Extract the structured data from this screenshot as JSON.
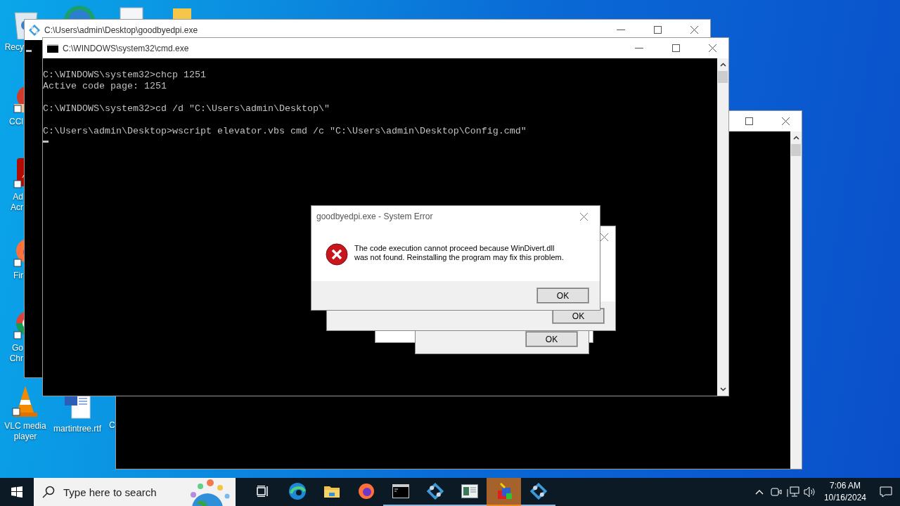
{
  "desktop_icons": [
    {
      "kind": "recycle",
      "label": [
        "Recy"
      ]
    },
    {
      "kind": "ccleaner",
      "label": [
        "CCl"
      ]
    },
    {
      "kind": "acrobat",
      "label": [
        "Ad",
        "Acr"
      ]
    },
    {
      "kind": "firefox",
      "label": [
        "Fir"
      ]
    },
    {
      "kind": "chrome",
      "label": [
        "Go",
        "Chr"
      ]
    },
    {
      "kind": "vlc",
      "label": [
        "VLC media",
        "player"
      ]
    },
    {
      "kind": "word",
      "label": [
        "martintree.rtf"
      ]
    },
    {
      "kind": "blank",
      "label": [
        "C"
      ]
    }
  ],
  "back_window": {
    "title": "C:\\Users\\admin\\Desktop\\goodbyedpi.exe"
  },
  "cmd_window": {
    "title": "C:\\WINDOWS\\system32\\cmd.exe",
    "blocks": [
      [
        "C:\\WINDOWS\\system32>chcp 1251",
        "Active code page: 1251"
      ],
      [
        "C:\\WINDOWS\\system32>cd /d \"C:\\Users\\admin\\Desktop\\\""
      ],
      [
        "C:\\Users\\admin\\Desktop>wscript elevator.vbs cmd /c \"C:\\Users\\admin\\Desktop\\Config.cmd\""
      ]
    ]
  },
  "background_dialogs": [
    {
      "button": "OK"
    },
    {
      "button": "OK"
    }
  ],
  "error_dialog": {
    "title": "goodbyedpi.exe - System Error",
    "message": "The code execution cannot proceed because WinDivert.dll\nwas not found. Reinstalling the program may fix this problem.",
    "button": "OK"
  },
  "taskbar": {
    "search": {
      "placeholder": "Type here to search"
    },
    "apps": [
      {
        "kind": "taskview",
        "running": false,
        "selected": false
      },
      {
        "kind": "edge",
        "running": false,
        "selected": false
      },
      {
        "kind": "explorer",
        "running": false,
        "selected": false
      },
      {
        "kind": "firefox",
        "running": false,
        "selected": false
      },
      {
        "kind": "terminal",
        "running": true,
        "selected": false
      },
      {
        "kind": "gear",
        "running": true,
        "selected": false
      },
      {
        "kind": "window",
        "running": true,
        "selected": false
      },
      {
        "kind": "package",
        "running": true,
        "selected": true
      },
      {
        "kind": "gear",
        "running": true,
        "selected": false
      }
    ],
    "time": "7:06 AM",
    "date": "10/16/2024"
  }
}
